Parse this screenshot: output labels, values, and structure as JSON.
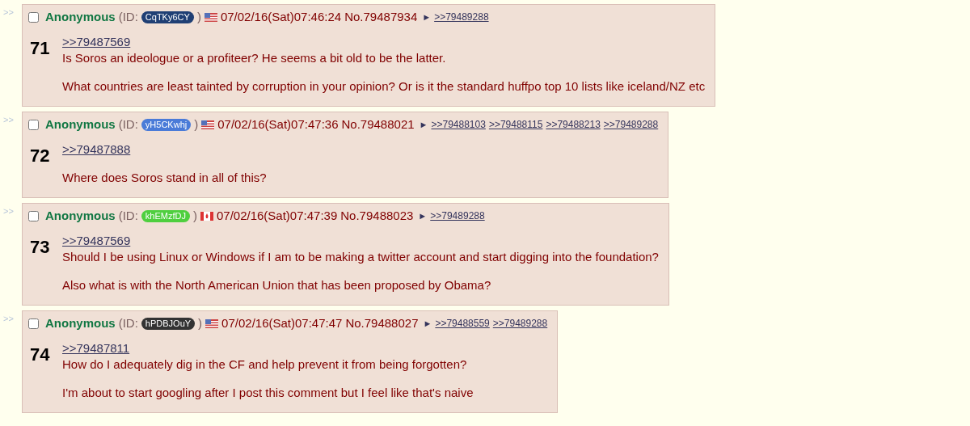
{
  "posts": [
    {
      "marker": ">>",
      "checked": false,
      "name": "Anonymous",
      "id_label": "(ID:",
      "id": "CqTKy6CY",
      "id_close": ")",
      "color": "#1f3f74",
      "flag": {
        "kind": "us"
      },
      "datetime": "07/02/16(Sat)07:46:24",
      "number": "No.79487934",
      "arrow": "►",
      "replies": [
        ">>79489288"
      ],
      "index": "71",
      "paragraphs": [
        [
          {
            "kind": "quote",
            "text": ">>79487569"
          },
          {
            "kind": "text",
            "text": "Is Soros an ideologue or a profiteer? He seems a bit old to be the latter."
          }
        ],
        [
          {
            "kind": "text",
            "text": "What countries are least tainted by corruption in your opinion? Or is it the standard huffpo top 10 lists like iceland/NZ etc"
          }
        ]
      ]
    },
    {
      "marker": ">>",
      "checked": false,
      "name": "Anonymous",
      "id_label": "(ID:",
      "id": "yH5CKwhj",
      "id_close": ")",
      "color": "#4a7bd8",
      "flag": {
        "kind": "us"
      },
      "datetime": "07/02/16(Sat)07:47:36",
      "number": "No.79488021",
      "arrow": "►",
      "replies": [
        ">>79488103",
        ">>79488115",
        ">>79488213",
        ">>79489288"
      ],
      "index": "72",
      "paragraphs": [
        [
          {
            "kind": "quote",
            "text": ">>79487888"
          }
        ],
        [
          {
            "kind": "text",
            "text": "Where does Soros stand in all of this?"
          }
        ]
      ]
    },
    {
      "marker": ">>",
      "checked": false,
      "name": "Anonymous",
      "id_label": "(ID:",
      "id": "khEMzfDJ",
      "id_close": ")",
      "color": "#4fcf3f",
      "flag": {
        "kind": "ca"
      },
      "datetime": "07/02/16(Sat)07:47:39",
      "number": "No.79488023",
      "arrow": "►",
      "replies": [
        ">>79489288"
      ],
      "index": "73",
      "paragraphs": [
        [
          {
            "kind": "quote",
            "text": ">>79487569"
          },
          {
            "kind": "text",
            "text": "Should I be using Linux or Windows if I am to be making a twitter account and start digging into the foundation?"
          }
        ],
        [
          {
            "kind": "text",
            "text": "Also what is with the North American Union that has been proposed by Obama?"
          }
        ]
      ]
    },
    {
      "marker": ">>",
      "checked": false,
      "name": "Anonymous",
      "id_label": "(ID:",
      "id": "hPDBJOuY",
      "id_close": ")",
      "color": "#333333",
      "flag": {
        "kind": "us"
      },
      "datetime": "07/02/16(Sat)07:47:47",
      "number": "No.79488027",
      "arrow": "►",
      "replies": [
        ">>79488559",
        ">>79489288"
      ],
      "index": "74",
      "paragraphs": [
        [
          {
            "kind": "quote",
            "text": ">>79487811"
          },
          {
            "kind": "text",
            "text": "How do I adequately dig in the CF and help prevent it from being forgotten?"
          }
        ],
        [
          {
            "kind": "text",
            "text": "I'm about to start googling after I post this comment but I feel like that's naive"
          }
        ]
      ]
    }
  ]
}
